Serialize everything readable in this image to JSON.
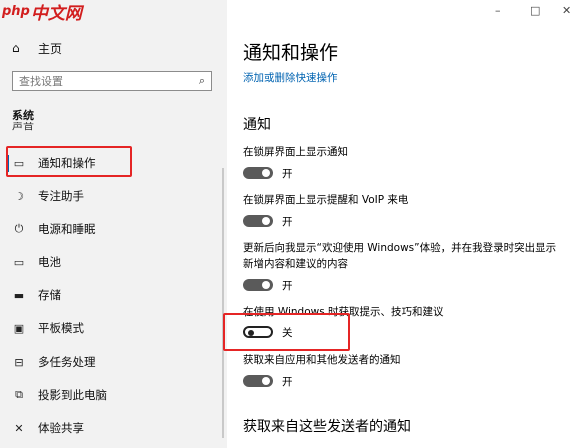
{
  "app": {
    "logo_prefix": "php",
    "logo_text": "中文网"
  },
  "window_controls": {
    "minimize": "–",
    "maximize": "□",
    "close": "✕"
  },
  "sidebar": {
    "home_label": "主页",
    "search_placeholder": "查找设置",
    "category": "系统",
    "clipped_item": "声音",
    "items": [
      {
        "label": "通知和操作",
        "icon": "message-icon",
        "selected": true
      },
      {
        "label": "专注助手",
        "icon": "moon-icon"
      },
      {
        "label": "电源和睡眠",
        "icon": "power-icon"
      },
      {
        "label": "电池",
        "icon": "battery-icon"
      },
      {
        "label": "存储",
        "icon": "storage-icon"
      },
      {
        "label": "平板模式",
        "icon": "tablet-icon"
      },
      {
        "label": "多任务处理",
        "icon": "multitask-icon"
      },
      {
        "label": "投影到此电脑",
        "icon": "projection-icon"
      },
      {
        "label": "体验共享",
        "icon": "share-icon"
      }
    ]
  },
  "main": {
    "title": "通知和操作",
    "quick_actions_link": "添加或删除快速操作",
    "notifications_section": "通知",
    "settings": [
      {
        "label": "在锁屏界面上显示通知",
        "state": "开",
        "on": true
      },
      {
        "label": "在锁屏界面上显示提醒和 VoIP 来电",
        "state": "开",
        "on": true
      },
      {
        "label_line1": "更新后向我显示“欢迎使用 Windows”体验，并在我登录时突出显示",
        "label_line2": "新增内容和建议的内容",
        "state": "开",
        "on": true
      },
      {
        "label": "在使用 Windows 时获取提示、技巧和建议",
        "state": "关",
        "on": false
      },
      {
        "label": "获取来自应用和其他发送者的通知",
        "state": "开",
        "on": true
      }
    ],
    "senders_section": "获取来自这些发送者的通知"
  },
  "colors": {
    "accent": "#0063b1",
    "highlight_box": "#e52525",
    "logo": "#d21e1e"
  }
}
